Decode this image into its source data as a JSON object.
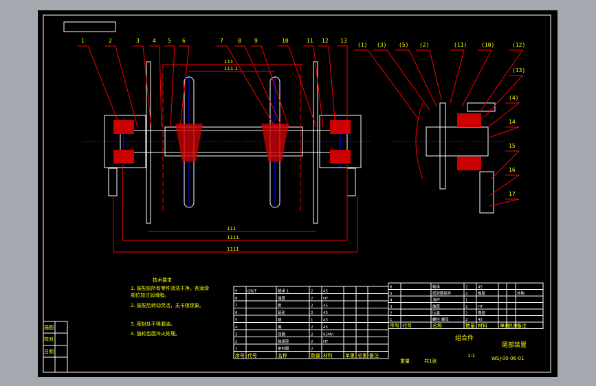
{
  "balloons_left": [
    "1",
    "2",
    "3",
    "4",
    "5",
    "6",
    "7",
    "8",
    "9",
    "10",
    "11",
    "12",
    "13"
  ],
  "balloons_right": [
    "(1)",
    "(3)",
    "(5)",
    "(2)",
    "(11)",
    "(10)",
    "(12)",
    "(13)",
    "(4)",
    "14",
    "15",
    "16",
    "17"
  ],
  "dimensions": {
    "top_outer": "111",
    "top_inner": "111.1",
    "bottom_1": "111",
    "bottom_2": "1111",
    "bottom_3": "1111"
  },
  "notes": {
    "title": "技术要求",
    "lines": [
      "1. 装配前所有零件清洗干净，各润滑",
      "   部位加注润滑脂。",
      "2. 装配后转动灵活，无卡阻现象。",
      "3. 密封处不得漏油。",
      "4. 链轮齿面淬火处理。"
    ]
  },
  "parts_left": [
    [
      "9",
      "GB/T",
      "轴承 1",
      "2",
      "45",
      "",
      "",
      ""
    ],
    [
      "8",
      "",
      "端盖",
      "2",
      "HT",
      "",
      "",
      ""
    ],
    [
      "7",
      "",
      "套",
      "2",
      "45",
      "",
      "",
      ""
    ],
    [
      "6",
      "",
      "链轮",
      "2",
      "45",
      "",
      "",
      ""
    ],
    [
      "5",
      "",
      "轴",
      "1",
      "45",
      "",
      "",
      ""
    ],
    [
      "4",
      "",
      "键",
      "2",
      "45",
      "",
      "",
      ""
    ],
    [
      "3",
      "",
      "挡圈",
      "2",
      "65Mn",
      "",
      "",
      ""
    ],
    [
      "2",
      "",
      "轴承座",
      "2",
      "HT",
      "",
      "",
      ""
    ],
    [
      "1",
      "",
      "密封圈",
      "2",
      "",
      "",
      "",
      ""
    ]
  ],
  "parts_right": [
    [
      "6",
      "",
      "轴承",
      "2",
      "45",
      "",
      "",
      ""
    ],
    [
      "5",
      "",
      "密封圈组件",
      "2",
      "橡胶",
      "",
      "",
      "外购"
    ],
    [
      "4",
      "",
      "油杯",
      "1",
      "",
      "",
      "",
      ""
    ],
    [
      "3",
      "",
      "端盖",
      "2",
      "HT",
      "",
      "",
      ""
    ],
    [
      "2",
      "",
      "压盖",
      "2",
      "橡胶",
      "",
      "",
      ""
    ],
    [
      "1",
      "",
      "螺栓 螺母",
      "2",
      "45",
      "",
      "",
      ""
    ]
  ],
  "table_headers": [
    "序号",
    "代号",
    "名称",
    "数量",
    "材料",
    "单重",
    "总重",
    "备注"
  ],
  "title_block": {
    "assembly": "组合件",
    "name": "尾部装置",
    "scale": "1:1",
    "drawing_no": "WSJ-00-06-01",
    "weight": "重量",
    "sheet": "共1张"
  },
  "side_labels": [
    "描图",
    "校对",
    "日期"
  ]
}
